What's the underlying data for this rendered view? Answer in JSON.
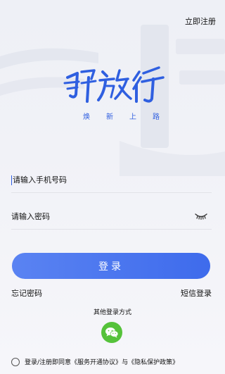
{
  "header": {
    "register_label": "立即注册"
  },
  "brand": {
    "logo_text": "解放行",
    "slogan": [
      "焕",
      "新",
      "上",
      "路"
    ],
    "accent_color": "#2f5fe0"
  },
  "form": {
    "phone_placeholder": "请输入手机号码",
    "password_placeholder": "请输入密码",
    "login_label": "登录"
  },
  "links": {
    "forgot_password": "忘记密码",
    "sms_login": "短信登录"
  },
  "other_login": {
    "title": "其他登录方式",
    "icon": "wechat-icon",
    "icon_color": "#55c23a"
  },
  "agreement": {
    "prefix": "登录/注册即同意",
    "service": "《服务开通协议》",
    "conjunction": "与",
    "privacy": "《隐私保护政策》"
  }
}
